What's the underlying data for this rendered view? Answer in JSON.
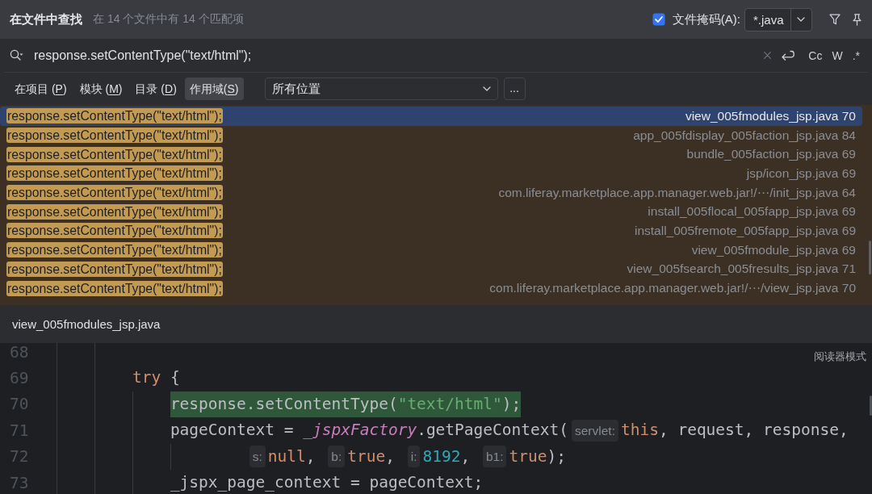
{
  "header": {
    "title": "在文件中查找",
    "summary": "在 14 个文件中有 14 个匹配项",
    "file_mask": {
      "checked": true,
      "label": "文件掩码(A):",
      "value": "*.java"
    }
  },
  "search": {
    "value": "response.setContentType(\"text/html\");",
    "options": [
      {
        "label": "Cc",
        "selected": false
      },
      {
        "label": "W",
        "selected": false
      },
      {
        "label": ".*",
        "selected": false
      }
    ]
  },
  "scopes": [
    {
      "prefix": "在项目 (",
      "mnemonic": "P",
      "suffix": ")",
      "selected": false
    },
    {
      "prefix": "模块 (",
      "mnemonic": "M",
      "suffix": ")",
      "selected": false
    },
    {
      "prefix": "目录 (",
      "mnemonic": "D",
      "suffix": ")",
      "selected": false
    },
    {
      "prefix": "作用域(",
      "mnemonic": "S",
      "suffix": ")",
      "selected": true
    }
  ],
  "scope_dropdown": {
    "value": "所有位置",
    "more": "..."
  },
  "results": [
    {
      "match": "response.setContentType(\"text/html\");",
      "location": "view_005fmodules_jsp.java 70",
      "selected": true
    },
    {
      "match": "response.setContentType(\"text/html\");",
      "location": "app_005fdisplay_005faction_jsp.java 84",
      "selected": false
    },
    {
      "match": "response.setContentType(\"text/html\");",
      "location": "bundle_005faction_jsp.java 69",
      "selected": false
    },
    {
      "match": "response.setContentType(\"text/html\");",
      "location": "jsp/icon_jsp.java 69",
      "selected": false
    },
    {
      "match": "response.setContentType(\"text/html\");",
      "location": "com.liferay.marketplace.app.manager.web.jar!/⋯/init_jsp.java 64",
      "selected": false
    },
    {
      "match": "response.setContentType(\"text/html\");",
      "location": "install_005flocal_005fapp_jsp.java 69",
      "selected": false
    },
    {
      "match": "response.setContentType(\"text/html\");",
      "location": "install_005fremote_005fapp_jsp.java 69",
      "selected": false
    },
    {
      "match": "response.setContentType(\"text/html\");",
      "location": "view_005fmodule_jsp.java 69",
      "selected": false
    },
    {
      "match": "response.setContentType(\"text/html\");",
      "location": "view_005fsearch_005fresults_jsp.java 71",
      "selected": false
    },
    {
      "match": "response.setContentType(\"text/html\");",
      "location": "com.liferay.marketplace.app.manager.web.jar!/⋯/view_jsp.java 70",
      "selected": false
    }
  ],
  "preview": {
    "file": "view_005fmodules_jsp.java",
    "reader_mode": "阅读器模式",
    "lines": [
      {
        "number": "68",
        "match": false
      },
      {
        "number": "69",
        "match": false,
        "tokens": [
          {
            "kind": "keyword",
            "text": "        try"
          },
          {
            "kind": "plain",
            "text": " {"
          }
        ]
      },
      {
        "number": "70",
        "match": true,
        "tokens": [
          {
            "kind": "plain",
            "text": "            response.setContentType("
          },
          {
            "kind": "string",
            "text": "\"text/html\""
          },
          {
            "kind": "plain",
            "text": ");"
          }
        ]
      },
      {
        "number": "71",
        "match": false,
        "tokens": [
          {
            "kind": "plain",
            "text": "            pageContext = "
          },
          {
            "kind": "static",
            "text": "_jspxFactory"
          },
          {
            "kind": "plain",
            "text": ".getPageContext("
          },
          {
            "kind": "hint",
            "text": "servlet:"
          },
          {
            "kind": "keyword",
            "text": "this"
          },
          {
            "kind": "plain",
            "text": ", request, response,"
          }
        ]
      },
      {
        "number": "72",
        "match": false,
        "tokens": [
          {
            "kind": "hint",
            "text": "                    s:"
          },
          {
            "kind": "keyword",
            "text": "null"
          },
          {
            "kind": "plain",
            "text": ", "
          },
          {
            "kind": "hint",
            "text": "b:"
          },
          {
            "kind": "keyword",
            "text": "true"
          },
          {
            "kind": "plain",
            "text": ", "
          },
          {
            "kind": "hint",
            "text": "i:"
          },
          {
            "kind": "number",
            "text": "8192"
          },
          {
            "kind": "plain",
            "text": ", "
          },
          {
            "kind": "hint",
            "text": "b1:"
          },
          {
            "kind": "keyword",
            "text": "true"
          },
          {
            "kind": "plain",
            "text": ");"
          }
        ]
      },
      {
        "number": "73",
        "match": false,
        "tokens": [
          {
            "kind": "plain",
            "text": "            _jspx_page_context = pageContext;"
          }
        ]
      }
    ]
  }
}
